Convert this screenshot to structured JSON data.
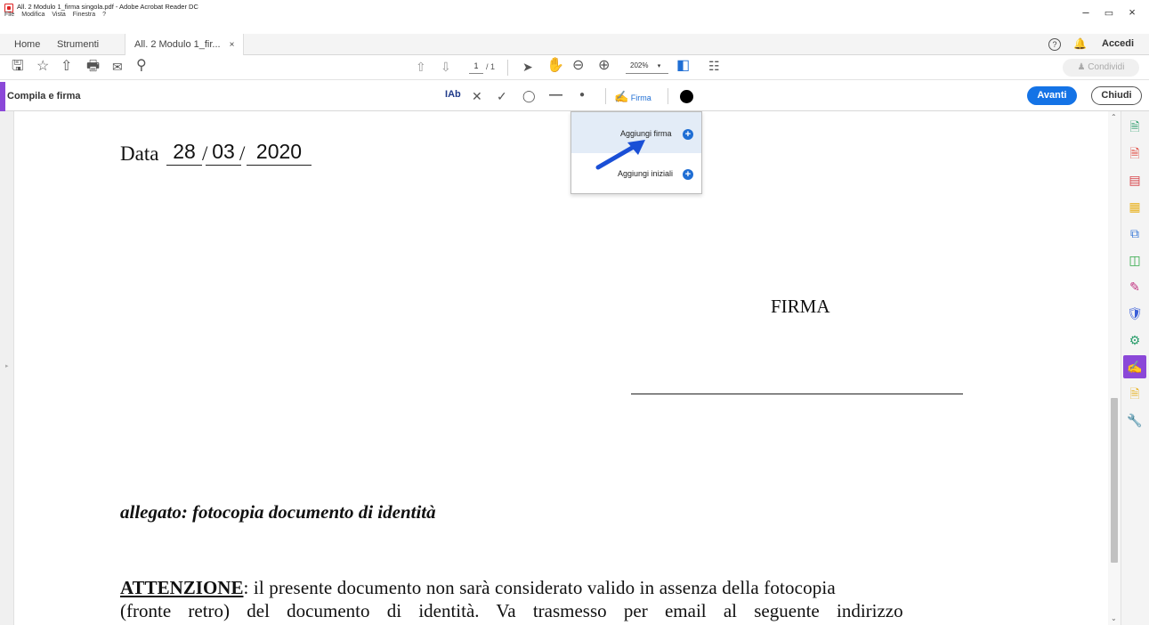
{
  "window": {
    "title": "All. 2 Modulo 1_firma singola.pdf - Adobe Acrobat Reader DC",
    "menu": [
      "File",
      "Modifica",
      "Vista",
      "Finestra",
      "?"
    ],
    "minimize": "–",
    "maximize": "▫",
    "close": "×"
  },
  "tabs": {
    "home": "Home",
    "strumenti": "Strumenti",
    "document": "All. 2 Modulo 1_fir...",
    "close": "×",
    "help_icon": "?",
    "accedi": "Accedi"
  },
  "toolbar": {
    "page_current": "1",
    "page_total": "/ 1",
    "zoom": "202%",
    "condividi": "Condividi"
  },
  "fillbar": {
    "label": "Compila e firma",
    "text_tool": "Ab",
    "firma": "Firma",
    "avanti": "Avanti",
    "chiudi": "Chiudi"
  },
  "dropdown": {
    "add_signature": "Aggiungi firma",
    "add_initials": "Aggiungi iniziali"
  },
  "document": {
    "date_label": "Data",
    "day": "28",
    "month": "03",
    "year": "2020",
    "slash": "/",
    "firma": "FIRMA",
    "allegato": "allegato: fotocopia documento di identità",
    "attenzione_bold": "ATTENZIONE",
    "attenzione_line1": ": il presente documento non sarà considerato valido in assenza della fotocopia",
    "attenzione_line2": "(fronte retro) del documento di identità. Va trasmesso per email al seguente indirizzo"
  },
  "colors": {
    "accent_purple": "#8b48d8",
    "accent_blue": "#1473e6",
    "arrow_blue": "#1a4fd6"
  },
  "icons": [
    "save-icon",
    "bookmark-star-icon",
    "upload-cloud-icon",
    "print-icon",
    "email-icon",
    "search-zoom-icon",
    "page-up-icon",
    "page-down-icon",
    "select-arrow-icon",
    "hand-icon",
    "zoom-out-icon",
    "zoom-in-icon",
    "fit-page-icon",
    "scroll-mode-icon"
  ]
}
